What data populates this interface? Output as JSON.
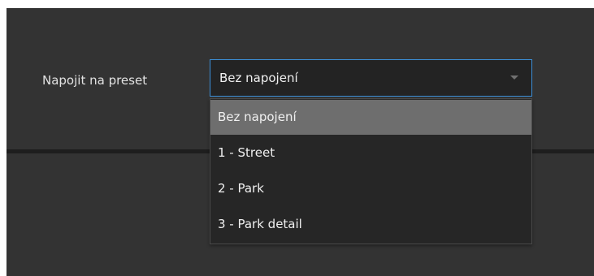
{
  "preset_field": {
    "label": "Napojit na preset",
    "selected_value": "Bez napojení",
    "arrow_icon": "chevron-down-icon",
    "options": [
      {
        "label": "Bez napojení",
        "selected": true
      },
      {
        "label": "1 - Street",
        "selected": false
      },
      {
        "label": "2 - Park",
        "selected": false
      },
      {
        "label": "3 - Park detail",
        "selected": false
      }
    ]
  },
  "colors": {
    "panel_background": "#333333",
    "select_border_focus": "#3c8fd8",
    "option_highlight": "#6e6e6e"
  }
}
